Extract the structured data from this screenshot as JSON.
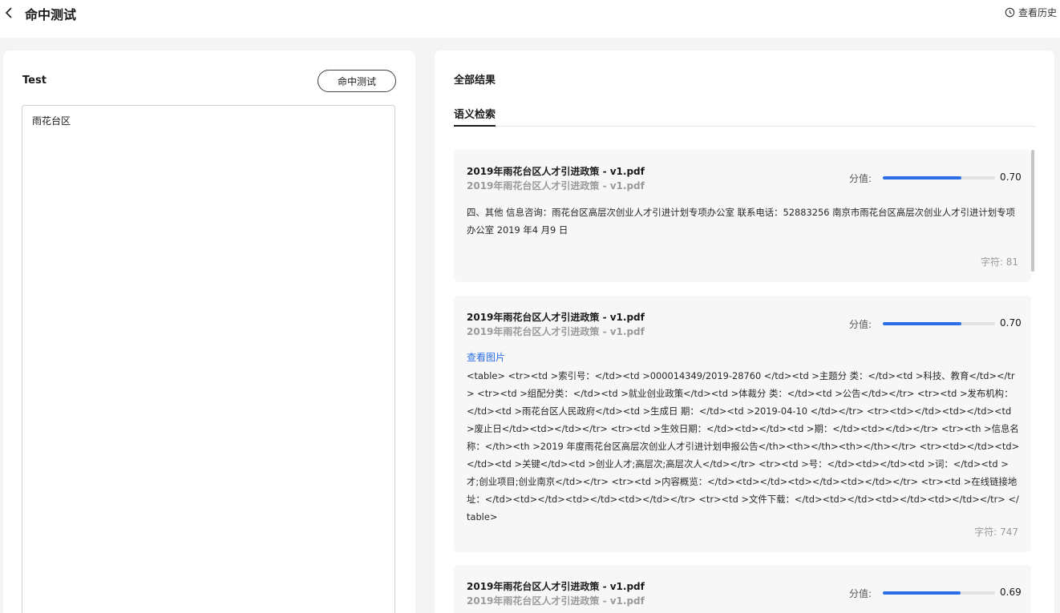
{
  "header": {
    "title": "命中测试",
    "history_label": "查看历史"
  },
  "left": {
    "title": "Test",
    "hit_button_label": "命中测试",
    "query_value": "雨花台区"
  },
  "right": {
    "title": "全部结果",
    "tab_label": "语义检索",
    "score_label": "分值:",
    "char_prefix": "字符: ",
    "view_image_label": "查看图片",
    "cards": [
      {
        "title": "2019年雨花台区人才引进政策 - v1.pdf",
        "subtitle": "2019年雨花台区人才引进政策 - v1.pdf",
        "score": 0.7,
        "score_text": "0.70",
        "text": "四、其他 信息咨询：雨花台区高层次创业人才引进计划专项办公室 联系电话：52883256 南京市雨花台区高层次创业人才引进计划专项办公室 2019 年4 月9 日",
        "chars": "字符: 81"
      },
      {
        "title": "2019年雨花台区人才引进政策 - v1.pdf",
        "subtitle": "2019年雨花台区人才引进政策 - v1.pdf",
        "score": 0.7,
        "score_text": "0.70",
        "text": "<table> <tr><td >索引号：</td><td >000014349/2019-28760 </td><td >主题分 类：</td><td >科技、教育</td></tr> <tr><td >组配分类：</td><td >就业创业政策</td><td >体裁分 类：</td><td >公告</td></tr> <tr><td >发布机构：</td><td >雨花台区人民政府</td><td >生成日 期：</td><td >2019-04-10 </td></tr> <tr><td></td><td></td><td >废止日</td><td></td></tr> <tr><td >生效日期：</td><td></td><td >期：</td><td></td></tr> <tr><th >信息名称：</th><th >2019 年度雨花台区高层次创业人才引进计划申报公告</th><th></th><th></th></tr> <tr><td></td><td></td><td >关键</td><td >创业人才;高层次;高层次人</td></tr> <tr><td >号：</td><td></td><td >词：</td><td > 才;创业项目;创业南京</td></tr> <tr><td >内容概览：</td><td></td><td></td><td></td></tr> <tr><td >在线链接地 址：</td><td></td><td></td><td></td></tr> <tr><td >文件下载：</td><td></td><td></td><td></td></tr> </table>",
        "chars": "字符: 747"
      },
      {
        "title": "2019年雨花台区人才引进政策 - v1.pdf",
        "subtitle": "2019年雨花台区人才引进政策 - v1.pdf",
        "score": 0.69,
        "score_text": "0.69"
      }
    ]
  }
}
